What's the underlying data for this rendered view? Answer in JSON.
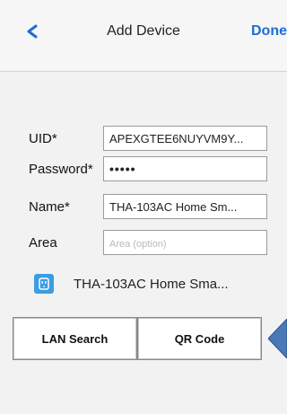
{
  "navbar": {
    "back_glyph": "<",
    "title": "Add Device",
    "done_label": "Done"
  },
  "form": {
    "uid": {
      "label": "UID*",
      "value": "APEXGTEE6NUYVM9Y..."
    },
    "password": {
      "label": "Password*",
      "value": "•••••"
    },
    "name": {
      "label": "Name*",
      "value": "THA-103AC Home Sm..."
    },
    "area": {
      "label": "Area",
      "value": "",
      "placeholder": "Area (option)"
    }
  },
  "device": {
    "icon": "smart-plug-icon",
    "name": "THA-103AC Home Sma..."
  },
  "actions": {
    "lan_search_label": "LAN Search",
    "qr_code_label": "QR Code"
  },
  "colors": {
    "accent": "#1a6fd6",
    "device_icon": "#3b9de3",
    "pointer_arrow": "#4a78b8"
  }
}
